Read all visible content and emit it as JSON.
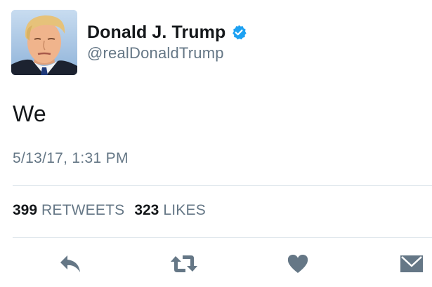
{
  "user": {
    "display_name": "Donald J. Trump",
    "handle": "@realDonaldTrump",
    "verified": true
  },
  "tweet": {
    "text": "We",
    "timestamp": "5/13/17, 1:31 PM"
  },
  "stats": {
    "retweets_count": "399",
    "retweets_label": "RETWEETS",
    "likes_count": "323",
    "likes_label": "LIKES"
  },
  "actions": [
    {
      "name": "reply",
      "icon": "reply-icon"
    },
    {
      "name": "retweet",
      "icon": "retweet-icon"
    },
    {
      "name": "like",
      "icon": "heart-icon"
    },
    {
      "name": "direct-message",
      "icon": "envelope-icon"
    }
  ],
  "colors": {
    "text_primary": "#14171a",
    "text_secondary": "#657786",
    "verified_blue": "#1da1f2",
    "icon_gray": "#657786",
    "divider": "#e1e8ed"
  }
}
